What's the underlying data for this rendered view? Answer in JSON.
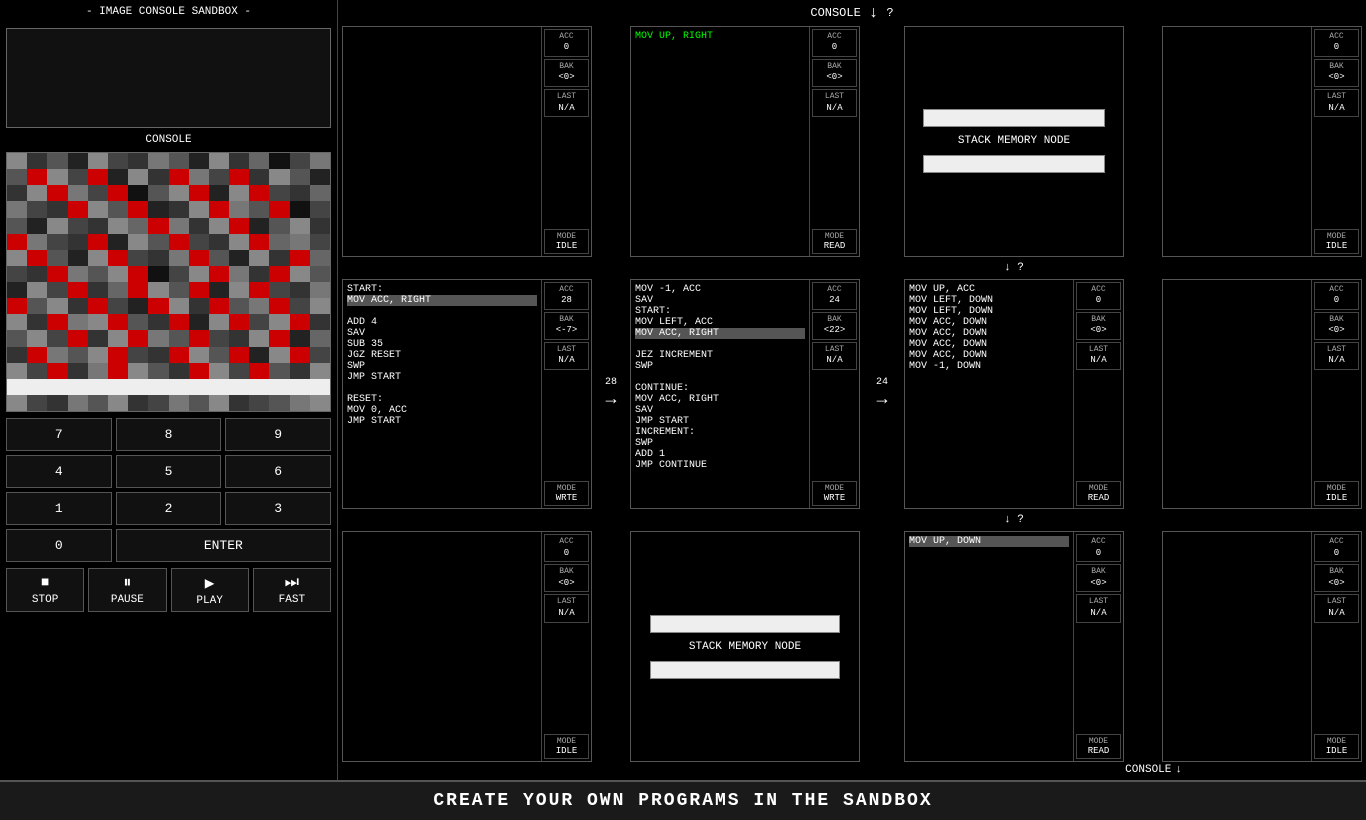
{
  "app": {
    "title": "- IMAGE CONSOLE SANDBOX -",
    "console_label": "CONSOLE",
    "footer_text": "CREATE YOUR OWN PROGRAMS IN THE SANDBOX"
  },
  "header": {
    "console": "CONSOLE",
    "arrow": "↓",
    "question": "?"
  },
  "controls": {
    "stop_label": "STOP",
    "pause_label": "PAUSE",
    "play_label": "PLAY",
    "fast_label": "FAST"
  },
  "numpad": {
    "buttons": [
      "7",
      "8",
      "9",
      "4",
      "5",
      "6",
      "1",
      "2",
      "3",
      "0",
      "ENTER"
    ]
  },
  "nodes": {
    "row1": [
      {
        "id": "node-r1c1",
        "code": "",
        "highlight": "",
        "acc": "0",
        "bak": "<0>",
        "last": "N/A",
        "mode": "IDLE"
      },
      {
        "id": "node-r1c2",
        "code": "MOV UP, RIGHT",
        "highlight": "",
        "acc": "0",
        "bak": "<0>",
        "last": "N/A",
        "mode": "READ"
      },
      {
        "id": "node-r1c3-stack",
        "type": "stack",
        "label": "STACK MEMORY NODE",
        "bar1": true,
        "bar2": true
      },
      {
        "id": "node-r1c4",
        "code": "",
        "highlight": "",
        "acc": "0",
        "bak": "<0>",
        "last": "N/A",
        "mode": "IDLE"
      }
    ],
    "row2": [
      {
        "id": "node-r2c1",
        "code": "START:\nMOV ACC, RIGHT\nADD 4\nSAV\nSUB 35\nJGZ RESET\nSWP\nJMP START\n\nRESET:\nMOV 0, ACC\nJMP START",
        "highlight": "MOV ACC, RIGHT",
        "acc": "28",
        "bak": "<-7>",
        "last": "N/A",
        "mode": "WRTE"
      },
      {
        "id": "node-r2c2",
        "code": "MOV -1, ACC\nSAV\nSTART:\nMOV LEFT, ACC\nMOV ACC, RIGHT\nJEZ INCREMENT\nSWP\n\nCONTINUE:\nMOV ACC, RIGHT\nSAV\nJMP START\nINCREMENT:\nSWP\nADD 1\nJMP CONTINUE",
        "highlight": "MOV ACC, RIGHT",
        "acc": "24",
        "bak": "<22>",
        "last": "N/A",
        "mode": "WRTE"
      },
      {
        "id": "node-r2c3",
        "code": "MOV UP, ACC\nMOV LEFT, DOWN\nMOV LEFT, DOWN\nMOV ACC, DOWN\nMOV ACC, DOWN\nMOV ACC, DOWN\nMOV ACC, DOWN\nMOV -1, DOWN",
        "highlight": "",
        "acc": "0",
        "bak": "<0>",
        "last": "N/A",
        "mode": "READ"
      },
      {
        "id": "node-r2c4",
        "code": "",
        "highlight": "",
        "acc": "0",
        "bak": "<0>",
        "last": "N/A",
        "mode": "IDLE"
      }
    ],
    "row3": [
      {
        "id": "node-r3c1",
        "code": "",
        "highlight": "",
        "acc": "0",
        "bak": "<0>",
        "last": "N/A",
        "mode": "IDLE"
      },
      {
        "id": "node-r3c2-stack",
        "type": "stack",
        "label": "STACK MEMORY NODE",
        "bar1": true,
        "bar2": true
      },
      {
        "id": "node-r3c3",
        "code": "MOV UP, DOWN",
        "highlight": "MOV UP, DOWN",
        "acc": "0",
        "bak": "<0>",
        "last": "N/A",
        "mode": "READ"
      },
      {
        "id": "node-r3c4",
        "code": "",
        "highlight": "",
        "acc": "0",
        "bak": "<0>",
        "last": "N/A",
        "mode": "IDLE"
      }
    ]
  },
  "arrows": {
    "r2c1_val": "28",
    "r2c2_val": "24",
    "console_bottom": "CONSOLE"
  },
  "pixel_colors": [
    "#888",
    "#333",
    "#555",
    "#222",
    "#888",
    "#444",
    "#333",
    "#777",
    "#555",
    "#222",
    "#888",
    "#333",
    "#666",
    "#111",
    "#444",
    "#777",
    "#555",
    "#cc0000",
    "#888",
    "#444",
    "#cc0000",
    "#222",
    "#888",
    "#333",
    "#cc0000",
    "#777",
    "#444",
    "#cc0000",
    "#333",
    "#888",
    "#555",
    "#222",
    "#333",
    "#888",
    "#cc0000",
    "#777",
    "#444",
    "#cc0000",
    "#111",
    "#555",
    "#888",
    "#cc0000",
    "#222",
    "#888",
    "#cc0000",
    "#444",
    "#333",
    "#666",
    "#777",
    "#444",
    "#333",
    "#cc0000",
    "#888",
    "#555",
    "#cc0000",
    "#222",
    "#333",
    "#888",
    "#cc0000",
    "#777",
    "#555",
    "#cc0000",
    "#111",
    "#444",
    "#555",
    "#222",
    "#888",
    "#444",
    "#333",
    "#888",
    "#666",
    "#cc0000",
    "#777",
    "#333",
    "#888",
    "#cc0000",
    "#222",
    "#555",
    "#888",
    "#333",
    "#cc0000",
    "#777",
    "#444",
    "#333",
    "#cc0000",
    "#222",
    "#888",
    "#555",
    "#cc0000",
    "#444",
    "#333",
    "#888",
    "#cc0000",
    "#666",
    "#777",
    "#444",
    "#888",
    "#cc0000",
    "#555",
    "#222",
    "#888",
    "#cc0000",
    "#444",
    "#333",
    "#777",
    "#cc0000",
    "#555",
    "#222",
    "#888",
    "#333",
    "#cc0000",
    "#666",
    "#444",
    "#333",
    "#cc0000",
    "#777",
    "#555",
    "#888",
    "#cc0000",
    "#111",
    "#444",
    "#888",
    "#cc0000",
    "#777",
    "#333",
    "#cc0000",
    "#888",
    "#555",
    "#222",
    "#888",
    "#444",
    "#cc0000",
    "#333",
    "#666",
    "#cc0000",
    "#888",
    "#555",
    "#cc0000",
    "#222",
    "#888",
    "#cc0000",
    "#444",
    "#333",
    "#777",
    "#cc0000",
    "#555",
    "#888",
    "#333",
    "#cc0000",
    "#444",
    "#222",
    "#cc0000",
    "#888",
    "#333",
    "#cc0000",
    "#555",
    "#777",
    "#cc0000",
    "#444",
    "#888",
    "#888",
    "#333",
    "#cc0000",
    "#777",
    "#888",
    "#cc0000",
    "#555",
    "#333",
    "#cc0000",
    "#222",
    "#888",
    "#cc0000",
    "#444",
    "#888",
    "#cc0000",
    "#333",
    "#555",
    "#888",
    "#444",
    "#cc0000",
    "#333",
    "#888",
    "#cc0000",
    "#777",
    "#555",
    "#cc0000",
    "#444",
    "#333",
    "#888",
    "#cc0000",
    "#222",
    "#666",
    "#333",
    "#cc0000",
    "#777",
    "#555",
    "#888",
    "#cc0000",
    "#444",
    "#333",
    "#cc0000",
    "#888",
    "#555",
    "#cc0000",
    "#222",
    "#888",
    "#cc0000",
    "#444",
    "#888",
    "#444",
    "#cc0000",
    "#333",
    "#777",
    "#cc0000",
    "#888",
    "#555",
    "#333",
    "#cc0000",
    "#888",
    "#444",
    "#cc0000",
    "#555",
    "#333",
    "#888",
    "#eee",
    "#eee",
    "#eee",
    "#eee",
    "#eee",
    "#eee",
    "#eee",
    "#eee",
    "#eee",
    "#eee",
    "#eee",
    "#eee",
    "#eee",
    "#eee",
    "#eee",
    "#eee",
    "#888",
    "#444",
    "#333",
    "#777",
    "#555",
    "#888",
    "#333",
    "#444",
    "#777",
    "#555",
    "#888",
    "#333",
    "#444",
    "#555",
    "#777",
    "#888"
  ]
}
